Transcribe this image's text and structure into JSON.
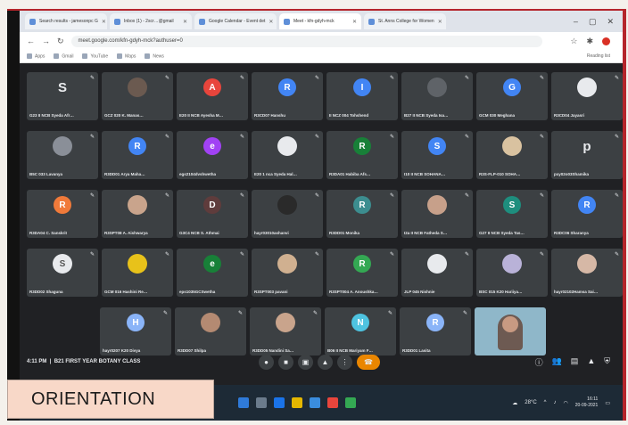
{
  "browser": {
    "tabs": [
      {
        "label": "Search results - jamesonpc G",
        "active": false
      },
      {
        "label": "Inbox (1) - 2scr…@gmail",
        "active": false
      },
      {
        "label": "Google Calendar - Event det",
        "active": false
      },
      {
        "label": "Meet - kfn-gdyh-mck",
        "active": true
      },
      {
        "label": "St. Anns College for Women",
        "active": false
      }
    ],
    "url": "meet.google.com/kfn-gdyh-mck?authuser=0",
    "bookmarks": [
      "Apps",
      "Gmail",
      "YouTube",
      "Maps",
      "News"
    ],
    "reading_list": "Reading list"
  },
  "meeting": {
    "time": "4:11 PM",
    "title": "B21 FIRST YEAR BOTANY CLASS"
  },
  "participants": [
    {
      "letter": "S",
      "name": "G23 II NCB Syeda Afr…",
      "color": "",
      "kind": "letter"
    },
    {
      "letter": "",
      "name": "GCZ 020 K. Manas…",
      "color": "#6b5a50",
      "kind": "photo"
    },
    {
      "letter": "A",
      "name": "E20 II NCB Ayesha M…",
      "color": "#e8453c",
      "kind": "avatar"
    },
    {
      "letter": "R",
      "name": "R3CD07 Hanshu",
      "color": "#4285f4",
      "kind": "avatar"
    },
    {
      "letter": "I",
      "name": "II NCZ 004 Tohshend",
      "color": "#4285f4",
      "kind": "avatar"
    },
    {
      "letter": "",
      "name": "B27 II NCB Syeda Isa…",
      "color": "#5f6368",
      "kind": "photo"
    },
    {
      "letter": "G",
      "name": "GCM 030 Meghana",
      "color": "#4285f4",
      "kind": "avatar"
    },
    {
      "letter": "",
      "name": "R3CD04 Jayasri",
      "color": "#e8eaed",
      "kind": "photo"
    },
    {
      "letter": "",
      "name": "B5C 033 Lavanya",
      "color": "#8a8f98",
      "kind": "photo"
    },
    {
      "letter": "R",
      "name": "R3DD01 Arya Maha…",
      "color": "#4285f4",
      "kind": "avatar"
    },
    {
      "letter": "e",
      "name": "egs2104dvshwetha",
      "color": "#a142f4",
      "kind": "avatar"
    },
    {
      "letter": "",
      "name": "E20 1 nca Syeda Hal…",
      "color": "#e8eaed",
      "kind": "photo"
    },
    {
      "letter": "R",
      "name": "R3DA01 Habiba Afs…",
      "color": "#188038",
      "kind": "avatar"
    },
    {
      "letter": "S",
      "name": "I10 II NCB SOHANA…",
      "color": "#4285f4",
      "kind": "avatar"
    },
    {
      "letter": "",
      "name": "R3S-FLP-010 SOHA…",
      "color": "#d9c2a0",
      "kind": "photo"
    },
    {
      "letter": "p",
      "name": "pxy02o03Shamika",
      "color": "",
      "kind": "letter"
    },
    {
      "letter": "R",
      "name": "R3DA04 C. Sanskrit",
      "color": "#f07a3a",
      "kind": "avatar"
    },
    {
      "letter": "",
      "name": "R3SPT08 A. Aishwarya",
      "color": "#c9a48c",
      "kind": "photo"
    },
    {
      "letter": "D",
      "name": "G3C4 NCB S. Athmai",
      "color": "#5f3c3c",
      "kind": "avatar"
    },
    {
      "letter": "",
      "name": "hayr03010ashanvi",
      "color": "#2a2a2a",
      "kind": "photo"
    },
    {
      "letter": "R",
      "name": "R3DD01 Monika",
      "color": "#3c8d8f",
      "kind": "avatar"
    },
    {
      "letter": "",
      "name": "I2a II NCB Fatheda S…",
      "color": "#c7a08a",
      "kind": "photo"
    },
    {
      "letter": "S",
      "name": "G27 II NCB Syeda Tas…",
      "color": "#1e8e7e",
      "kind": "avatar"
    },
    {
      "letter": "R",
      "name": "R3DC06 Sharanya",
      "color": "#4285f4",
      "kind": "avatar"
    },
    {
      "letter": "S",
      "name": "R3DD02 Shaguna",
      "color": "#e8eaed",
      "kind": "photo"
    },
    {
      "letter": "",
      "name": "GCM 016 Hashini Re…",
      "color": "#e8c21a",
      "kind": "photo"
    },
    {
      "letter": "e",
      "name": "eps1035GCSwetha",
      "color": "#188038",
      "kind": "avatar"
    },
    {
      "letter": "",
      "name": "R3SPT003 pavani",
      "color": "#d0b090",
      "kind": "photo"
    },
    {
      "letter": "R",
      "name": "R3SPT004 A. Anoushka…",
      "color": "#34a853",
      "kind": "avatar"
    },
    {
      "letter": "",
      "name": "JLP 045 Nishnie",
      "color": "#e8eaed",
      "kind": "photo"
    },
    {
      "letter": "",
      "name": "BSC 015 K20 Hariiya…",
      "color": "#b9b2d8",
      "kind": "photo"
    },
    {
      "letter": "",
      "name": "hayr02102Hamsa Sai…",
      "color": "#d6b8a6",
      "kind": "photo"
    },
    {
      "letter": "H",
      "name": "hayr0207 K20 Divya",
      "color": "#8ab4f8",
      "kind": "avatar"
    },
    {
      "letter": "",
      "name": "R3DD07 Shilpa",
      "color": "#b48a72",
      "kind": "photo"
    },
    {
      "letter": "",
      "name": "R3DD05 Nandini Sa…",
      "color": "#c9a48c",
      "kind": "photo"
    },
    {
      "letter": "N",
      "name": "B06 II NCB Mariyam F…",
      "color": "#4ec3e0",
      "kind": "avatar"
    },
    {
      "letter": "R",
      "name": "R3DD01 Lasita",
      "color": "#8ab4f8",
      "kind": "avatar"
    },
    {
      "letter": "",
      "name": "",
      "color": "#8fb7c9",
      "kind": "self"
    }
  ],
  "tray": {
    "temperature": "28°C",
    "time": "16:11",
    "date": "20-09-2021"
  },
  "caption": "ORIENTATION"
}
